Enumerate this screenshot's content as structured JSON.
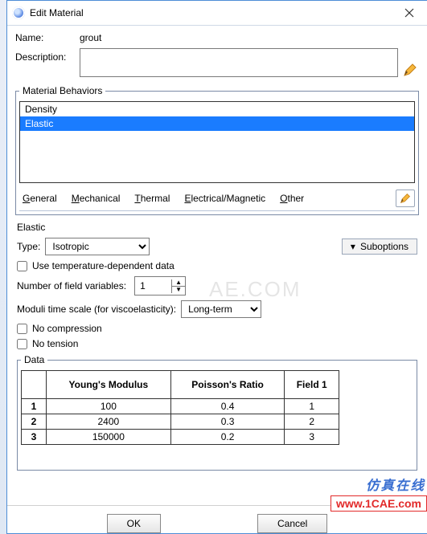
{
  "window": {
    "title": "Edit Material"
  },
  "form": {
    "name_label": "Name:",
    "name_value": "grout",
    "description_label": "Description:",
    "description_value": ""
  },
  "behaviors": {
    "legend": "Material Behaviors",
    "items": [
      "Density",
      "Elastic"
    ],
    "selected_index": 1
  },
  "menus": {
    "general": "eneral",
    "mechanical": "echanical",
    "thermal": "hermal",
    "em": "lectrical/Magnetic",
    "other": "ther"
  },
  "elastic": {
    "title": "Elastic",
    "type_label": "Type:",
    "type_value": "Isotropic",
    "suboptions_label": "Suboptions",
    "temp_dep_label": "Use temperature-dependent data",
    "field_vars_label": "Number of field variables:",
    "field_vars_value": "1",
    "moduli_label": "Moduli time scale (for viscoelasticity):",
    "moduli_value": "Long-term",
    "no_compression_label": "No compression",
    "no_tension_label": "No tension"
  },
  "data": {
    "legend": "Data",
    "columns": [
      "Young's Modulus",
      "Poisson's Ratio",
      "Field 1"
    ],
    "rows": [
      {
        "n": "1",
        "ym": "100",
        "pr": "0.4",
        "f1": "1"
      },
      {
        "n": "2",
        "ym": "2400",
        "pr": "0.3",
        "f1": "2"
      },
      {
        "n": "3",
        "ym": "150000",
        "pr": "0.2",
        "f1": "3"
      }
    ]
  },
  "buttons": {
    "ok": "OK",
    "cancel": "Cancel"
  },
  "watermarks": {
    "ghost": "AE.COM",
    "blue": "仿真在线",
    "red": "www.1CAE.com"
  },
  "chart_data": {
    "type": "table",
    "title": "Elastic Data",
    "columns": [
      "Young's Modulus",
      "Poisson's Ratio",
      "Field 1"
    ],
    "rows": [
      [
        100,
        0.4,
        1
      ],
      [
        2400,
        0.3,
        2
      ],
      [
        150000,
        0.2,
        3
      ]
    ]
  }
}
